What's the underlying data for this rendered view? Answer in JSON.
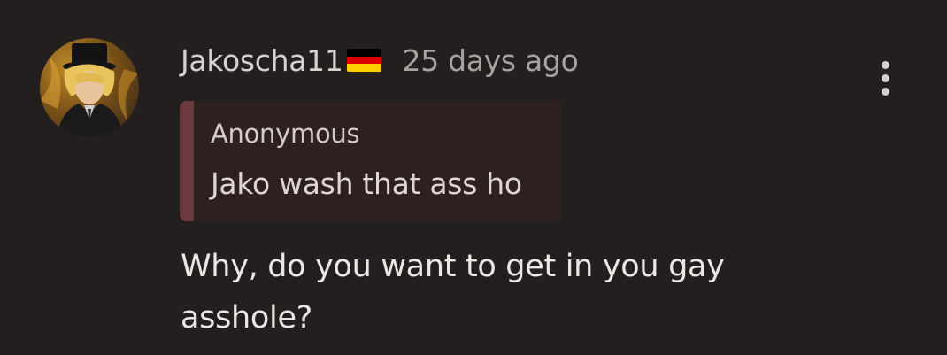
{
  "comment": {
    "username": "Jakoscha11",
    "flag_icon": "germany-flag-icon",
    "flag_colors": [
      "#000000",
      "#dd0000",
      "#ffce00"
    ],
    "timestamp": "25 days ago",
    "menu_icon": "more-vertical-icon",
    "quote": {
      "author": "Anonymous",
      "text": "Jako wash that ass ho"
    },
    "body": "Why, do you want to get in you gay asshole?"
  },
  "colors": {
    "background": "#231f1f",
    "quote_background": "#2e2020",
    "quote_accent": "#6b3a3f"
  }
}
